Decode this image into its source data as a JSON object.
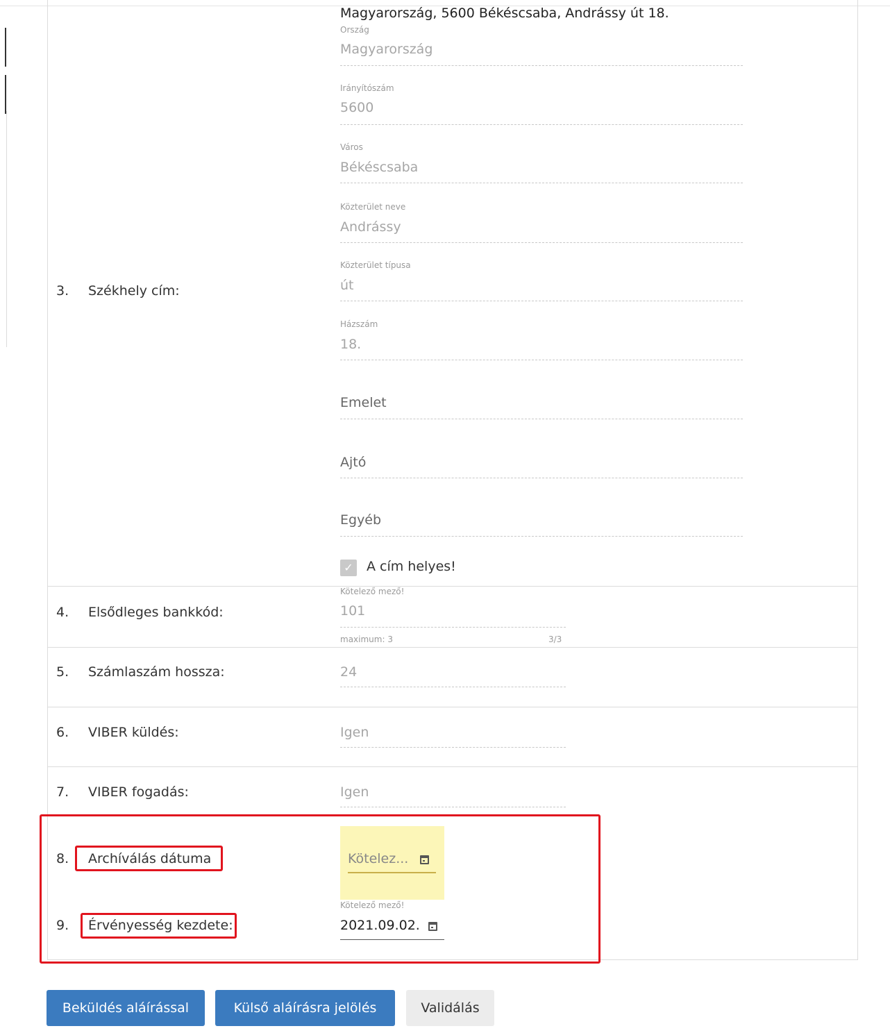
{
  "address": {
    "summary": "Magyarország, 5600 Békéscsaba, Andrássy út 18.",
    "fields": [
      {
        "label": "Ország",
        "value": "Magyarország"
      },
      {
        "label": "Irányítószám",
        "value": "5600"
      },
      {
        "label": "Város",
        "value": "Békéscsaba"
      },
      {
        "label": "Közterület neve",
        "value": "Andrássy"
      },
      {
        "label": "Közterület típusa",
        "value": "út"
      },
      {
        "label": "Házszám",
        "value": "18."
      }
    ],
    "placeholders": {
      "floor": "Emelet",
      "door": "Ajtó",
      "other": "Egyéb"
    },
    "checkbox": {
      "label": "A cím helyes!",
      "checked": true
    }
  },
  "rows": [
    {
      "num": "3.",
      "label": "Székhely cím:"
    },
    {
      "num": "4.",
      "label": "Elsődleges bankkód:",
      "hint": "Kötelező mező!",
      "value": "101",
      "counter_left": "maximum: 3",
      "counter_right": "3/3"
    },
    {
      "num": "5.",
      "label": "Számlaszám hossza:",
      "value": "24"
    },
    {
      "num": "6.",
      "label": "VIBER küldés:",
      "value": "Igen"
    },
    {
      "num": "7.",
      "label": "VIBER fogadás:",
      "value": "Igen"
    },
    {
      "num": "8.",
      "label": "Archíválás dátuma",
      "placeholder": "Kötelez..."
    },
    {
      "num": "9.",
      "label": "Érvényesség kezdete:",
      "hint": "Kötelező mező!",
      "value": "2021.09.02."
    }
  ],
  "buttons": {
    "submit": "Beküldés aláírással",
    "external": "Külső aláírásra jelölés",
    "validate": "Validálás"
  },
  "colors": {
    "highlight_red": "#e1141e",
    "primary_button": "#3b7bbf",
    "required_yellow": "#fcf6b8"
  }
}
